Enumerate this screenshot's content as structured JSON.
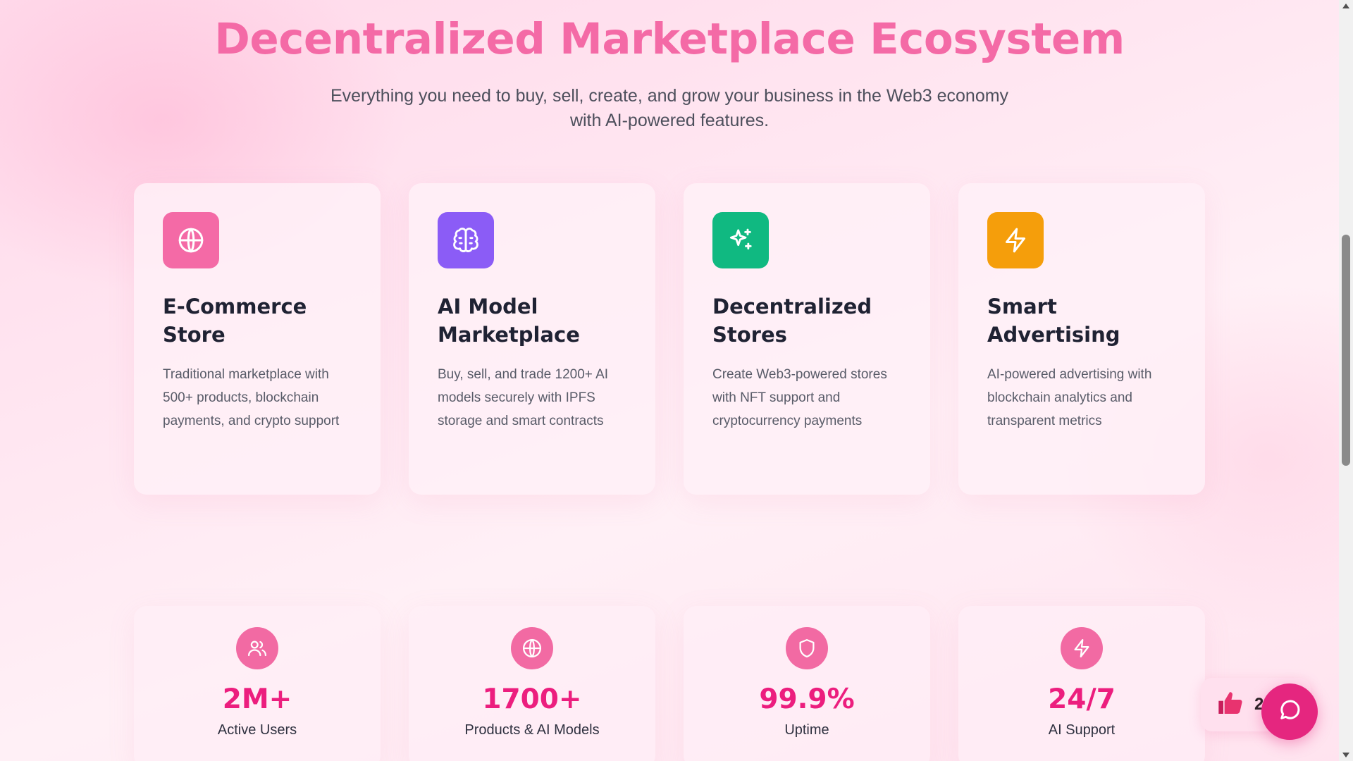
{
  "hero": {
    "title": "Decentralized Marketplace Ecosystem",
    "subtitle_line1": "Everything you need to buy, sell, create, and grow your business in the Web3 economy",
    "subtitle_line2": "with AI-powered features."
  },
  "features": [
    {
      "title": "E-Commerce Store",
      "description": "Traditional marketplace with 500+ products, blockchain payments, and crypto support",
      "icon": "globe-icon",
      "color": "#f46aa6"
    },
    {
      "title": "AI Model Marketplace",
      "description": "Buy, sell, and trade 1200+ AI models securely with IPFS storage and smart contracts",
      "icon": "brain-icon",
      "color": "#8b5cf6"
    },
    {
      "title": "Decentralized Stores",
      "description": "Create Web3-powered stores with NFT support and cryptocurrency payments",
      "icon": "sparkles-icon",
      "color": "#10b981"
    },
    {
      "title": "Smart Advertising",
      "description": "AI-powered advertising with blockchain analytics and transparent metrics",
      "icon": "lightning-icon",
      "color": "#f59e0b"
    }
  ],
  "stats": [
    {
      "value": "2M+",
      "label": "Active Users",
      "icon": "users-icon"
    },
    {
      "value": "1700+",
      "label": "Products & AI Models",
      "icon": "globe-icon"
    },
    {
      "value": "99.9%",
      "label": "Uptime",
      "icon": "shield-icon"
    },
    {
      "value": "24/7",
      "label": "AI Support",
      "icon": "lightning-icon"
    }
  ],
  "widgets": {
    "reaction_count": "2",
    "reaction_icon": "thumbs-up-icon",
    "chat_icon": "chat-bubble-icon"
  },
  "colors": {
    "accent_pink": "#f46aa6",
    "stat_value": "#ec1e7e",
    "chat_button": "#e5267f"
  }
}
